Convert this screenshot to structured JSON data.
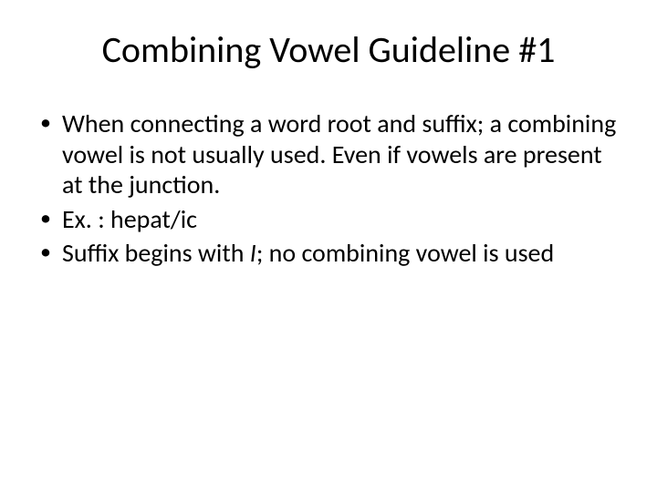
{
  "slide": {
    "title": "Combining Vowel Guideline #1",
    "bullets": [
      {
        "text": "When connecting a word root and suffix; a combining vowel is not usually used.  Even if vowels are present at the junction."
      },
      {
        "text": "Ex. :  hepat/ic"
      },
      {
        "prefix": "Suffix begins with ",
        "italic": "I",
        "suffix": "; no combining vowel is used"
      }
    ]
  }
}
